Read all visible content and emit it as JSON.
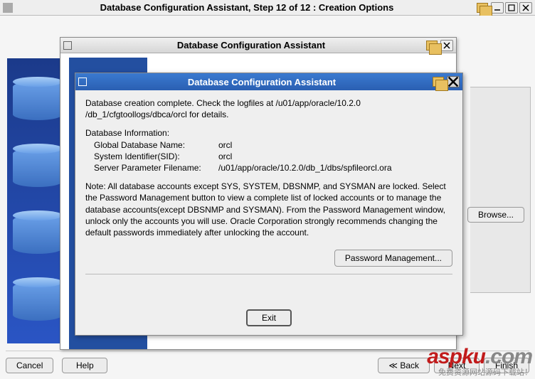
{
  "outer": {
    "title": "Database Configuration Assistant, Step 12 of 12 : Creation Options"
  },
  "window2": {
    "title": "Database Configuration Assistant"
  },
  "dialog": {
    "title": "Database Configuration Assistant",
    "creation_complete_line1": "Database creation complete. Check the logfiles at /u01/app/oracle/10.2.0",
    "creation_complete_line2": "/db_1/cfgtoollogs/dbca/orcl for details.",
    "db_info_heading": "Database Information:",
    "rows": {
      "gdn_label": "Global Database Name:",
      "gdn_value": "orcl",
      "sid_label": "System Identifier(SID):",
      "sid_value": "orcl",
      "spf_label": "Server Parameter Filename:",
      "spf_value": "/u01/app/oracle/10.2.0/db_1/dbs/spfileorcl.ora"
    },
    "note": "Note: All database accounts except SYS, SYSTEM, DBSNMP, and SYSMAN are locked. Select the Password Management button to view a complete list of locked accounts or to manage the database accounts(except DBSNMP and SYSMAN). From the Password Management window, unlock only the accounts you will use. Oracle Corporation strongly recommends changing the default passwords immediately after unlocking the account.",
    "password_mgmt_button": "Password Management...",
    "exit_button": "Exit"
  },
  "side_panel": {
    "browse_button": "Browse..."
  },
  "bottom": {
    "cancel": "Cancel",
    "help": "Help",
    "back": "Back",
    "next": "Next",
    "finish": "Finish"
  },
  "watermark": {
    "main": "aspku",
    "suffix": ".com",
    "sub": "免费资源网站源码下载站！"
  }
}
